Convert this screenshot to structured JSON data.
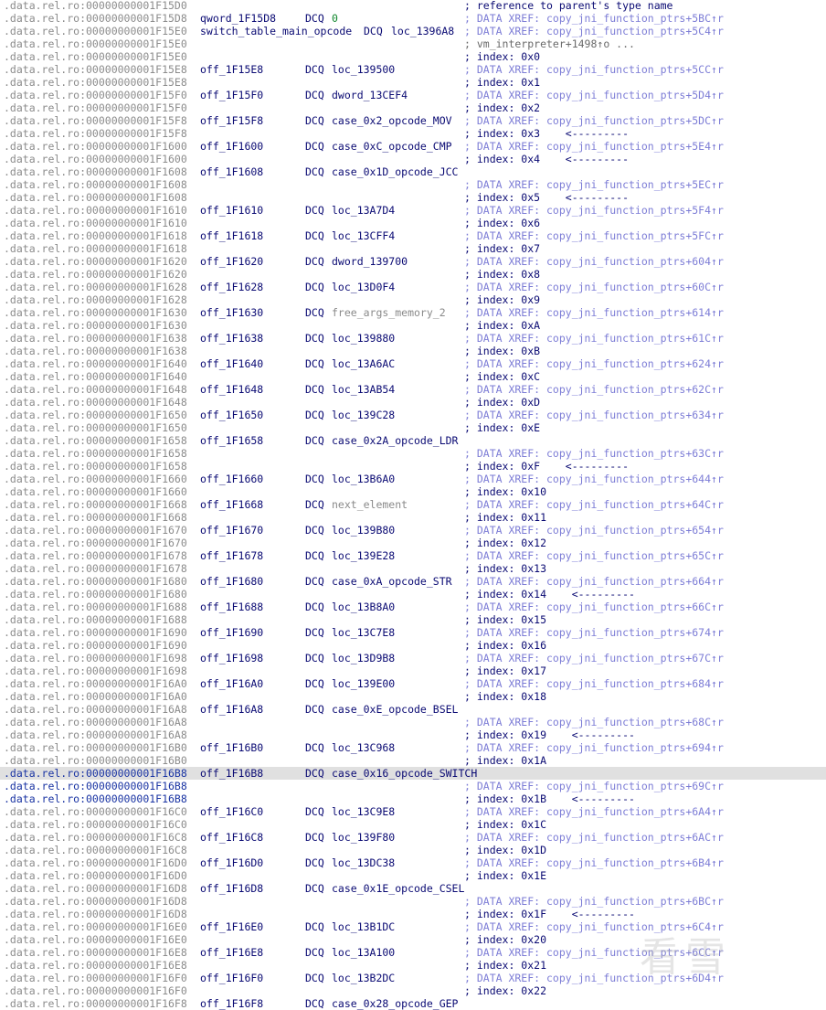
{
  "rows": [
    {
      "seg": ".data.rel.ro:00000000001F15D0",
      "label": "",
      "instr": "",
      "operand": "",
      "comment": "; reference to parent's type name",
      "ctype": "idx"
    },
    {
      "seg": ".data.rel.ro:00000000001F15D8",
      "label": "qword_1F15D8",
      "instr": "DCQ",
      "operand": "0",
      "otype": "num",
      "comment": "; DATA XREF: copy_jni_function_ptrs+5BC↑r",
      "ctype": "xref"
    },
    {
      "seg": ".data.rel.ro:00000000001F15E0",
      "label": "switch_table_main_opcode",
      "instr": "DCQ",
      "operand": "loc_1396A8",
      "comment": "; DATA XREF: copy_jni_function_ptrs+5C4↑r",
      "ctype": "xref",
      "longlabel": true
    },
    {
      "seg": ".data.rel.ro:00000000001F15E0",
      "label": "",
      "instr": "",
      "operand": "",
      "comment": "; vm_interpreter+1498↑o ...",
      "ctype": "plain"
    },
    {
      "seg": ".data.rel.ro:00000000001F15E0",
      "label": "",
      "instr": "",
      "operand": "",
      "comment": "; index: 0x0",
      "ctype": "idx"
    },
    {
      "seg": ".data.rel.ro:00000000001F15E8",
      "label": "off_1F15E8",
      "instr": "DCQ",
      "operand": "loc_139500",
      "comment": "; DATA XREF: copy_jni_function_ptrs+5CC↑r",
      "ctype": "xref"
    },
    {
      "seg": ".data.rel.ro:00000000001F15E8",
      "label": "",
      "instr": "",
      "operand": "",
      "comment": "; index: 0x1",
      "ctype": "idx"
    },
    {
      "seg": ".data.rel.ro:00000000001F15F0",
      "label": "off_1F15F0",
      "instr": "DCQ",
      "operand": "dword_13CEF4",
      "comment": "; DATA XREF: copy_jni_function_ptrs+5D4↑r",
      "ctype": "xref"
    },
    {
      "seg": ".data.rel.ro:00000000001F15F0",
      "label": "",
      "instr": "",
      "operand": "",
      "comment": "; index: 0x2",
      "ctype": "idx"
    },
    {
      "seg": ".data.rel.ro:00000000001F15F8",
      "label": "off_1F15F8",
      "instr": "DCQ",
      "operand": "case_0x2_opcode_MOV",
      "comment": "; DATA XREF: copy_jni_function_ptrs+5DC↑r",
      "ctype": "xref"
    },
    {
      "seg": ".data.rel.ro:00000000001F15F8",
      "label": "",
      "instr": "",
      "operand": "",
      "comment": "; index: 0x3    <---------",
      "ctype": "idx"
    },
    {
      "seg": ".data.rel.ro:00000000001F1600",
      "label": "off_1F1600",
      "instr": "DCQ",
      "operand": "case_0xC_opcode_CMP",
      "comment": "; DATA XREF: copy_jni_function_ptrs+5E4↑r",
      "ctype": "xref"
    },
    {
      "seg": ".data.rel.ro:00000000001F1600",
      "label": "",
      "instr": "",
      "operand": "",
      "comment": "; index: 0x4    <---------",
      "ctype": "idx"
    },
    {
      "seg": ".data.rel.ro:00000000001F1608",
      "label": "off_1F1608",
      "instr": "DCQ",
      "operand": "case_0x1D_opcode_JCC",
      "comment": "",
      "ctype": "xref"
    },
    {
      "seg": ".data.rel.ro:00000000001F1608",
      "label": "",
      "instr": "",
      "operand": "",
      "comment": "; DATA XREF: copy_jni_function_ptrs+5EC↑r",
      "ctype": "xref"
    },
    {
      "seg": ".data.rel.ro:00000000001F1608",
      "label": "",
      "instr": "",
      "operand": "",
      "comment": "; index: 0x5    <---------",
      "ctype": "idx"
    },
    {
      "seg": ".data.rel.ro:00000000001F1610",
      "label": "off_1F1610",
      "instr": "DCQ",
      "operand": "loc_13A7D4",
      "comment": "; DATA XREF: copy_jni_function_ptrs+5F4↑r",
      "ctype": "xref"
    },
    {
      "seg": ".data.rel.ro:00000000001F1610",
      "label": "",
      "instr": "",
      "operand": "",
      "comment": "; index: 0x6",
      "ctype": "idx"
    },
    {
      "seg": ".data.rel.ro:00000000001F1618",
      "label": "off_1F1618",
      "instr": "DCQ",
      "operand": "loc_13CFF4",
      "comment": "; DATA XREF: copy_jni_function_ptrs+5FC↑r",
      "ctype": "xref"
    },
    {
      "seg": ".data.rel.ro:00000000001F1618",
      "label": "",
      "instr": "",
      "operand": "",
      "comment": "; index: 0x7",
      "ctype": "idx"
    },
    {
      "seg": ".data.rel.ro:00000000001F1620",
      "label": "off_1F1620",
      "instr": "DCQ",
      "operand": "dword_139700",
      "comment": "; DATA XREF: copy_jni_function_ptrs+604↑r",
      "ctype": "xref"
    },
    {
      "seg": ".data.rel.ro:00000000001F1620",
      "label": "",
      "instr": "",
      "operand": "",
      "comment": "; index: 0x8",
      "ctype": "idx"
    },
    {
      "seg": ".data.rel.ro:00000000001F1628",
      "label": "off_1F1628",
      "instr": "DCQ",
      "operand": "loc_13D0F4",
      "comment": "; DATA XREF: copy_jni_function_ptrs+60C↑r",
      "ctype": "xref"
    },
    {
      "seg": ".data.rel.ro:00000000001F1628",
      "label": "",
      "instr": "",
      "operand": "",
      "comment": "; index: 0x9",
      "ctype": "idx"
    },
    {
      "seg": ".data.rel.ro:00000000001F1630",
      "label": "off_1F1630",
      "instr": "DCQ",
      "operand": "free_args_memory_2",
      "otype": "grey",
      "comment": "; DATA XREF: copy_jni_function_ptrs+614↑r",
      "ctype": "xref"
    },
    {
      "seg": ".data.rel.ro:00000000001F1630",
      "label": "",
      "instr": "",
      "operand": "",
      "comment": "; index: 0xA",
      "ctype": "idx"
    },
    {
      "seg": ".data.rel.ro:00000000001F1638",
      "label": "off_1F1638",
      "instr": "DCQ",
      "operand": "loc_139880",
      "comment": "; DATA XREF: copy_jni_function_ptrs+61C↑r",
      "ctype": "xref"
    },
    {
      "seg": ".data.rel.ro:00000000001F1638",
      "label": "",
      "instr": "",
      "operand": "",
      "comment": "; index: 0xB",
      "ctype": "idx"
    },
    {
      "seg": ".data.rel.ro:00000000001F1640",
      "label": "off_1F1640",
      "instr": "DCQ",
      "operand": "loc_13A6AC",
      "comment": "; DATA XREF: copy_jni_function_ptrs+624↑r",
      "ctype": "xref"
    },
    {
      "seg": ".data.rel.ro:00000000001F1640",
      "label": "",
      "instr": "",
      "operand": "",
      "comment": "; index: 0xC",
      "ctype": "idx"
    },
    {
      "seg": ".data.rel.ro:00000000001F1648",
      "label": "off_1F1648",
      "instr": "DCQ",
      "operand": "loc_13AB54",
      "comment": "; DATA XREF: copy_jni_function_ptrs+62C↑r",
      "ctype": "xref"
    },
    {
      "seg": ".data.rel.ro:00000000001F1648",
      "label": "",
      "instr": "",
      "operand": "",
      "comment": "; index: 0xD",
      "ctype": "idx"
    },
    {
      "seg": ".data.rel.ro:00000000001F1650",
      "label": "off_1F1650",
      "instr": "DCQ",
      "operand": "loc_139C28",
      "comment": "; DATA XREF: copy_jni_function_ptrs+634↑r",
      "ctype": "xref"
    },
    {
      "seg": ".data.rel.ro:00000000001F1650",
      "label": "",
      "instr": "",
      "operand": "",
      "comment": "; index: 0xE",
      "ctype": "idx"
    },
    {
      "seg": ".data.rel.ro:00000000001F1658",
      "label": "off_1F1658",
      "instr": "DCQ",
      "operand": "case_0x2A_opcode_LDR",
      "comment": "",
      "ctype": "xref"
    },
    {
      "seg": ".data.rel.ro:00000000001F1658",
      "label": "",
      "instr": "",
      "operand": "",
      "comment": "; DATA XREF: copy_jni_function_ptrs+63C↑r",
      "ctype": "xref"
    },
    {
      "seg": ".data.rel.ro:00000000001F1658",
      "label": "",
      "instr": "",
      "operand": "",
      "comment": "; index: 0xF    <---------",
      "ctype": "idx"
    },
    {
      "seg": ".data.rel.ro:00000000001F1660",
      "label": "off_1F1660",
      "instr": "DCQ",
      "operand": "loc_13B6A0",
      "comment": "; DATA XREF: copy_jni_function_ptrs+644↑r",
      "ctype": "xref"
    },
    {
      "seg": ".data.rel.ro:00000000001F1660",
      "label": "",
      "instr": "",
      "operand": "",
      "comment": "; index: 0x10",
      "ctype": "idx"
    },
    {
      "seg": ".data.rel.ro:00000000001F1668",
      "label": "off_1F1668",
      "instr": "DCQ",
      "operand": "next_element",
      "otype": "grey",
      "comment": "; DATA XREF: copy_jni_function_ptrs+64C↑r",
      "ctype": "xref"
    },
    {
      "seg": ".data.rel.ro:00000000001F1668",
      "label": "",
      "instr": "",
      "operand": "",
      "comment": "; index: 0x11",
      "ctype": "idx"
    },
    {
      "seg": ".data.rel.ro:00000000001F1670",
      "label": "off_1F1670",
      "instr": "DCQ",
      "operand": "loc_139B80",
      "comment": "; DATA XREF: copy_jni_function_ptrs+654↑r",
      "ctype": "xref"
    },
    {
      "seg": ".data.rel.ro:00000000001F1670",
      "label": "",
      "instr": "",
      "operand": "",
      "comment": "; index: 0x12",
      "ctype": "idx"
    },
    {
      "seg": ".data.rel.ro:00000000001F1678",
      "label": "off_1F1678",
      "instr": "DCQ",
      "operand": "loc_139E28",
      "comment": "; DATA XREF: copy_jni_function_ptrs+65C↑r",
      "ctype": "xref"
    },
    {
      "seg": ".data.rel.ro:00000000001F1678",
      "label": "",
      "instr": "",
      "operand": "",
      "comment": "; index: 0x13",
      "ctype": "idx"
    },
    {
      "seg": ".data.rel.ro:00000000001F1680",
      "label": "off_1F1680",
      "instr": "DCQ",
      "operand": "case_0xA_opcode_STR",
      "comment": "; DATA XREF: copy_jni_function_ptrs+664↑r",
      "ctype": "xref"
    },
    {
      "seg": ".data.rel.ro:00000000001F1680",
      "label": "",
      "instr": "",
      "operand": "",
      "comment": "; index: 0x14    <---------",
      "ctype": "idx"
    },
    {
      "seg": ".data.rel.ro:00000000001F1688",
      "label": "off_1F1688",
      "instr": "DCQ",
      "operand": "loc_13B8A0",
      "comment": "; DATA XREF: copy_jni_function_ptrs+66C↑r",
      "ctype": "xref"
    },
    {
      "seg": ".data.rel.ro:00000000001F1688",
      "label": "",
      "instr": "",
      "operand": "",
      "comment": "; index: 0x15",
      "ctype": "idx"
    },
    {
      "seg": ".data.rel.ro:00000000001F1690",
      "label": "off_1F1690",
      "instr": "DCQ",
      "operand": "loc_13C7E8",
      "comment": "; DATA XREF: copy_jni_function_ptrs+674↑r",
      "ctype": "xref"
    },
    {
      "seg": ".data.rel.ro:00000000001F1690",
      "label": "",
      "instr": "",
      "operand": "",
      "comment": "; index: 0x16",
      "ctype": "idx"
    },
    {
      "seg": ".data.rel.ro:00000000001F1698",
      "label": "off_1F1698",
      "instr": "DCQ",
      "operand": "loc_13D9B8",
      "comment": "; DATA XREF: copy_jni_function_ptrs+67C↑r",
      "ctype": "xref"
    },
    {
      "seg": ".data.rel.ro:00000000001F1698",
      "label": "",
      "instr": "",
      "operand": "",
      "comment": "; index: 0x17",
      "ctype": "idx"
    },
    {
      "seg": ".data.rel.ro:00000000001F16A0",
      "label": "off_1F16A0",
      "instr": "DCQ",
      "operand": "loc_139E00",
      "comment": "; DATA XREF: copy_jni_function_ptrs+684↑r",
      "ctype": "xref"
    },
    {
      "seg": ".data.rel.ro:00000000001F16A0",
      "label": "",
      "instr": "",
      "operand": "",
      "comment": "; index: 0x18",
      "ctype": "idx"
    },
    {
      "seg": ".data.rel.ro:00000000001F16A8",
      "label": "off_1F16A8",
      "instr": "DCQ",
      "operand": "case_0xE_opcode_BSEL",
      "comment": "",
      "ctype": "xref"
    },
    {
      "seg": ".data.rel.ro:00000000001F16A8",
      "label": "",
      "instr": "",
      "operand": "",
      "comment": "; DATA XREF: copy_jni_function_ptrs+68C↑r",
      "ctype": "xref"
    },
    {
      "seg": ".data.rel.ro:00000000001F16A8",
      "label": "",
      "instr": "",
      "operand": "",
      "comment": "; index: 0x19    <---------",
      "ctype": "idx"
    },
    {
      "seg": ".data.rel.ro:00000000001F16B0",
      "label": "off_1F16B0",
      "instr": "DCQ",
      "operand": "loc_13C968",
      "comment": "; DATA XREF: copy_jni_function_ptrs+694↑r",
      "ctype": "xref"
    },
    {
      "seg": ".data.rel.ro:00000000001F16B0",
      "label": "",
      "instr": "",
      "operand": "",
      "comment": "; index: 0x1A",
      "ctype": "idx"
    },
    {
      "seg": ".data.rel.ro:00000000001F16B8",
      "label": "off_1F16B8",
      "instr": "DCQ",
      "operand": "case_0x16_opcode_SWITCH",
      "comment": "",
      "ctype": "xref",
      "highlight": true
    },
    {
      "seg": ".data.rel.ro:00000000001F16B8",
      "label": "",
      "instr": "",
      "operand": "",
      "comment": "; DATA XREF: copy_jni_function_ptrs+69C↑r",
      "ctype": "xref",
      "selected": true
    },
    {
      "seg": ".data.rel.ro:00000000001F16B8",
      "label": "",
      "instr": "",
      "operand": "",
      "comment": "; index: 0x1B    <---------",
      "ctype": "idx",
      "selected": true
    },
    {
      "seg": ".data.rel.ro:00000000001F16C0",
      "label": "off_1F16C0",
      "instr": "DCQ",
      "operand": "loc_13C9E8",
      "comment": "; DATA XREF: copy_jni_function_ptrs+6A4↑r",
      "ctype": "xref"
    },
    {
      "seg": ".data.rel.ro:00000000001F16C0",
      "label": "",
      "instr": "",
      "operand": "",
      "comment": "; index: 0x1C",
      "ctype": "idx"
    },
    {
      "seg": ".data.rel.ro:00000000001F16C8",
      "label": "off_1F16C8",
      "instr": "DCQ",
      "operand": "loc_139F80",
      "comment": "; DATA XREF: copy_jni_function_ptrs+6AC↑r",
      "ctype": "xref"
    },
    {
      "seg": ".data.rel.ro:00000000001F16C8",
      "label": "",
      "instr": "",
      "operand": "",
      "comment": "; index: 0x1D",
      "ctype": "idx"
    },
    {
      "seg": ".data.rel.ro:00000000001F16D0",
      "label": "off_1F16D0",
      "instr": "DCQ",
      "operand": "loc_13DC38",
      "comment": "; DATA XREF: copy_jni_function_ptrs+6B4↑r",
      "ctype": "xref"
    },
    {
      "seg": ".data.rel.ro:00000000001F16D0",
      "label": "",
      "instr": "",
      "operand": "",
      "comment": "; index: 0x1E",
      "ctype": "idx"
    },
    {
      "seg": ".data.rel.ro:00000000001F16D8",
      "label": "off_1F16D8",
      "instr": "DCQ",
      "operand": "case_0x1E_opcode_CSEL",
      "comment": "",
      "ctype": "xref"
    },
    {
      "seg": ".data.rel.ro:00000000001F16D8",
      "label": "",
      "instr": "",
      "operand": "",
      "comment": "; DATA XREF: copy_jni_function_ptrs+6BC↑r",
      "ctype": "xref"
    },
    {
      "seg": ".data.rel.ro:00000000001F16D8",
      "label": "",
      "instr": "",
      "operand": "",
      "comment": "; index: 0x1F    <---------",
      "ctype": "idx"
    },
    {
      "seg": ".data.rel.ro:00000000001F16E0",
      "label": "off_1F16E0",
      "instr": "DCQ",
      "operand": "loc_13B1DC",
      "comment": "; DATA XREF: copy_jni_function_ptrs+6C4↑r",
      "ctype": "xref"
    },
    {
      "seg": ".data.rel.ro:00000000001F16E0",
      "label": "",
      "instr": "",
      "operand": "",
      "comment": "; index: 0x20",
      "ctype": "idx"
    },
    {
      "seg": ".data.rel.ro:00000000001F16E8",
      "label": "off_1F16E8",
      "instr": "DCQ",
      "operand": "loc_13A100",
      "comment": "; DATA XREF: copy_jni_function_ptrs+6CC↑r",
      "ctype": "xref"
    },
    {
      "seg": ".data.rel.ro:00000000001F16E8",
      "label": "",
      "instr": "",
      "operand": "",
      "comment": "; index: 0x21",
      "ctype": "idx"
    },
    {
      "seg": ".data.rel.ro:00000000001F16F0",
      "label": "off_1F16F0",
      "instr": "DCQ",
      "operand": "loc_13B2DC",
      "comment": "; DATA XREF: copy_jni_function_ptrs+6D4↑r",
      "ctype": "xref"
    },
    {
      "seg": ".data.rel.ro:00000000001F16F0",
      "label": "",
      "instr": "",
      "operand": "",
      "comment": "; index: 0x22",
      "ctype": "idx"
    },
    {
      "seg": ".data.rel.ro:00000000001F16F8",
      "label": "off_1F16F8",
      "instr": "DCQ",
      "operand": "case_0x28_opcode_GEP",
      "comment": "",
      "ctype": "xref"
    }
  ],
  "watermark": "看雪"
}
